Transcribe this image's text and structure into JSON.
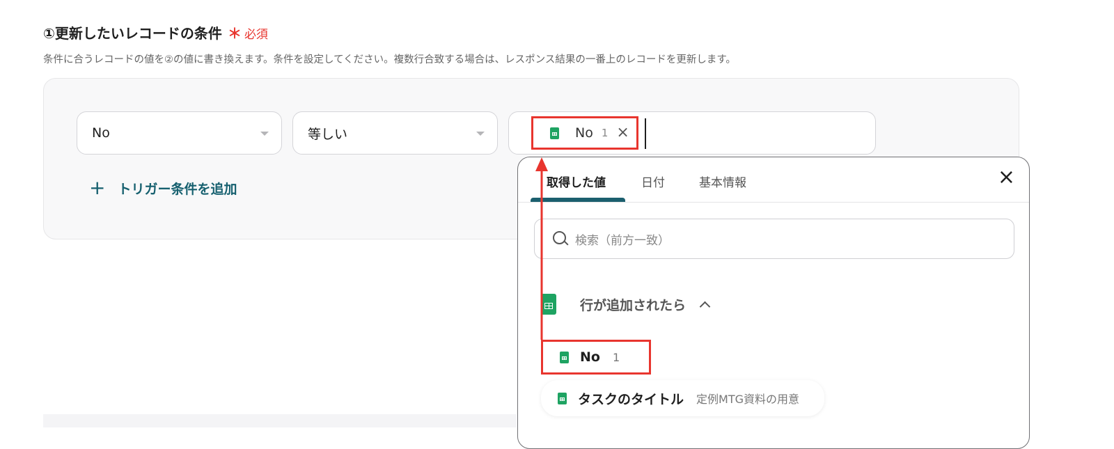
{
  "section": {
    "title": "①更新したいレコードの条件",
    "required_mark": "＊",
    "required_text": "必須",
    "description": "条件に合うレコードの値を②の値に書き換えます。条件を設定してください。複数行合致する場合は、レスポンス結果の一番上のレコードを更新します。"
  },
  "condition": {
    "field_value": "No",
    "operator_value": "等しい",
    "chip": {
      "label": "No",
      "index": "1",
      "remove_glyph": "×"
    }
  },
  "add_trigger": {
    "plus": "+",
    "label": "トリガー条件を追加"
  },
  "popup": {
    "tabs": [
      {
        "label": "取得した値",
        "active": true
      },
      {
        "label": "日付",
        "active": false
      },
      {
        "label": "基本情報",
        "active": false
      }
    ],
    "close_glyph": "×",
    "search": {
      "placeholder": "検索（前方一致）"
    },
    "group": {
      "title": "行が追加されたら"
    },
    "items": [
      {
        "name": "No",
        "meta": "1"
      },
      {
        "name": "タスクのタイトル",
        "meta": "定例MTG資料の用意"
      }
    ]
  },
  "icons": {
    "sheet": "google-sheets-icon",
    "search": "search-icon",
    "close": "close-icon"
  },
  "colors": {
    "highlight": "#e8352e",
    "accent": "#1b5f6e",
    "sheets_green": "#1ea362"
  }
}
